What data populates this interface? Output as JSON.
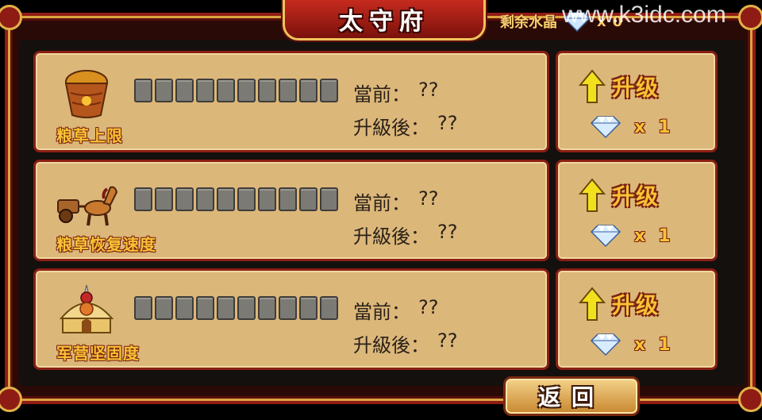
{
  "header": {
    "title": "太守府",
    "crystal_label": "剩余水晶",
    "crystal_x": "x",
    "crystal_value": "0",
    "watermark": "www.k3idc.com"
  },
  "rows": [
    {
      "label": "粮草上限",
      "icon": "grain-basket-icon",
      "progress_filled": 0,
      "progress_total": 10,
      "current_label": "當前：",
      "current_value": "??",
      "next_label": "升級後：",
      "next_value": "??",
      "upgrade_label": "升级",
      "cost_x": "x",
      "cost_value": "1"
    },
    {
      "label": "粮草恢复速度",
      "icon": "horse-cart-icon",
      "progress_filled": 0,
      "progress_total": 10,
      "current_label": "當前：",
      "current_value": "??",
      "next_label": "升級後：",
      "next_value": "??",
      "upgrade_label": "升级",
      "cost_x": "x",
      "cost_value": "1"
    },
    {
      "label": "军营坚固度",
      "icon": "army-tent-icon",
      "progress_filled": 0,
      "progress_total": 10,
      "current_label": "當前：",
      "current_value": "??",
      "next_label": "升級後：",
      "next_value": "??",
      "upgrade_label": "升级",
      "cost_x": "x",
      "cost_value": "1"
    }
  ],
  "footer": {
    "back_label": "返回"
  },
  "colors": {
    "frame_red": "#8f1c14",
    "gold": "#f7c335",
    "card_tan": "#dcb77a",
    "segment_empty": "#7b7a74"
  }
}
